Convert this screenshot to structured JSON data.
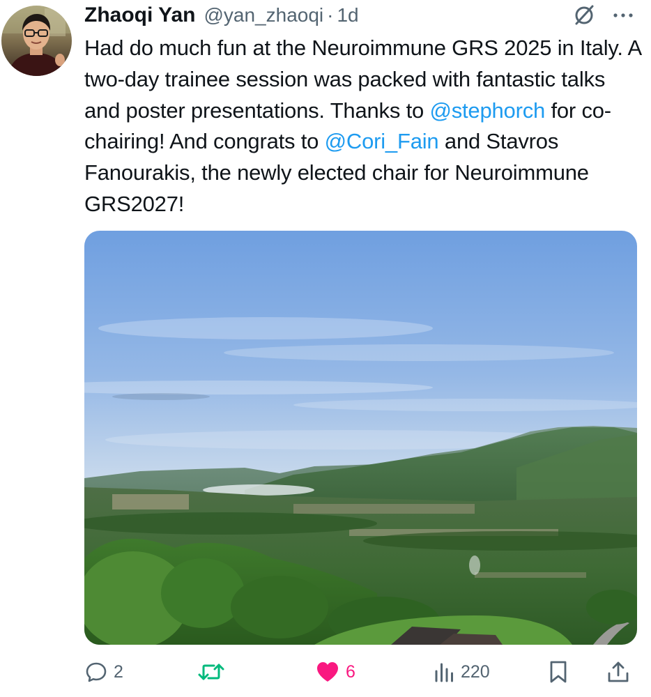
{
  "tweet": {
    "author": {
      "display_name": "Zhaoqi Yan",
      "handle": "@yan_zhaoqi",
      "separator": "·",
      "time": "1d"
    },
    "text": {
      "part1": "Had do much fun at the Neuroimmune GRS 2025 in Italy. A two-day trainee session was packed with fantastic talks and poster presentations. Thanks to ",
      "mention1": "@stephorch",
      "part2": " for co-chairing! And congrats to ",
      "mention2": "@Cori_Fain",
      "part3": " and Stavros Fanourakis, the newly elected chair for Neuroimmune GRS2027!"
    },
    "media": {
      "icon": "landscape-photo"
    },
    "actions": {
      "reply_count": "2",
      "repost_count": "",
      "like_count": "6",
      "views_count": "220"
    }
  },
  "icons": {
    "grok": "slashed-circle-icon",
    "more": "more-dots-icon",
    "reply": "speech-bubble-icon",
    "repost": "repost-arrows-icon",
    "like": "heart-icon",
    "views": "bar-chart-icon",
    "bookmark": "bookmark-icon",
    "share": "share-upload-icon"
  },
  "colors": {
    "text": "#0f1419",
    "secondary": "#536471",
    "link": "#1d9bf0",
    "repost_green": "#00ba7c",
    "like_pink": "#f91880"
  }
}
